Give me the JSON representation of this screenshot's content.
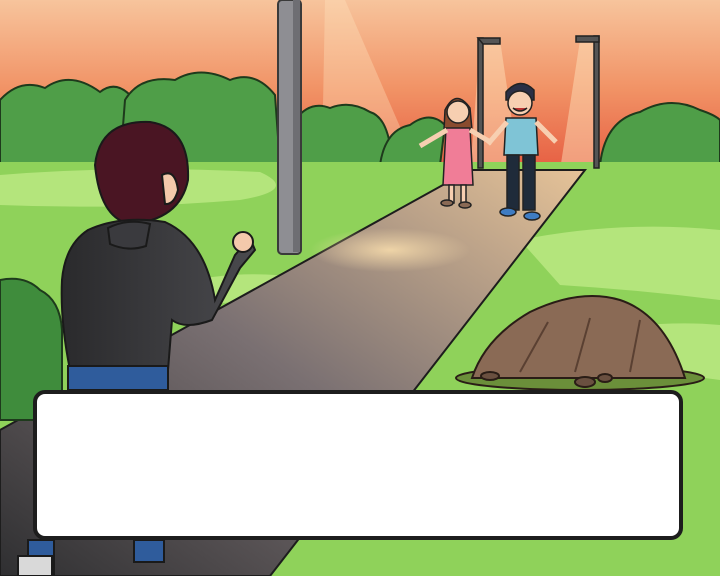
{
  "colors": {
    "sky_top": "#f6b48a",
    "sky_bottom": "#e8553c",
    "grass": "#8fd25a",
    "grass_light": "#b4e57c",
    "bush": "#4f9e48",
    "path_dark": "#3b3b3d",
    "path_light": "#c6b4a8",
    "dialogue_bg": "#ffffff",
    "dialogue_border": "#1d1d1d"
  },
  "scene": {
    "characters": [
      "player-boy-back-view",
      "girl-pink-dress",
      "boy-blue-shirt"
    ],
    "props": [
      "lamp-post",
      "street-lamp",
      "boulder",
      "bushes",
      "park-path"
    ]
  },
  "dialogue": {
    "speaker": "",
    "text": ""
  }
}
